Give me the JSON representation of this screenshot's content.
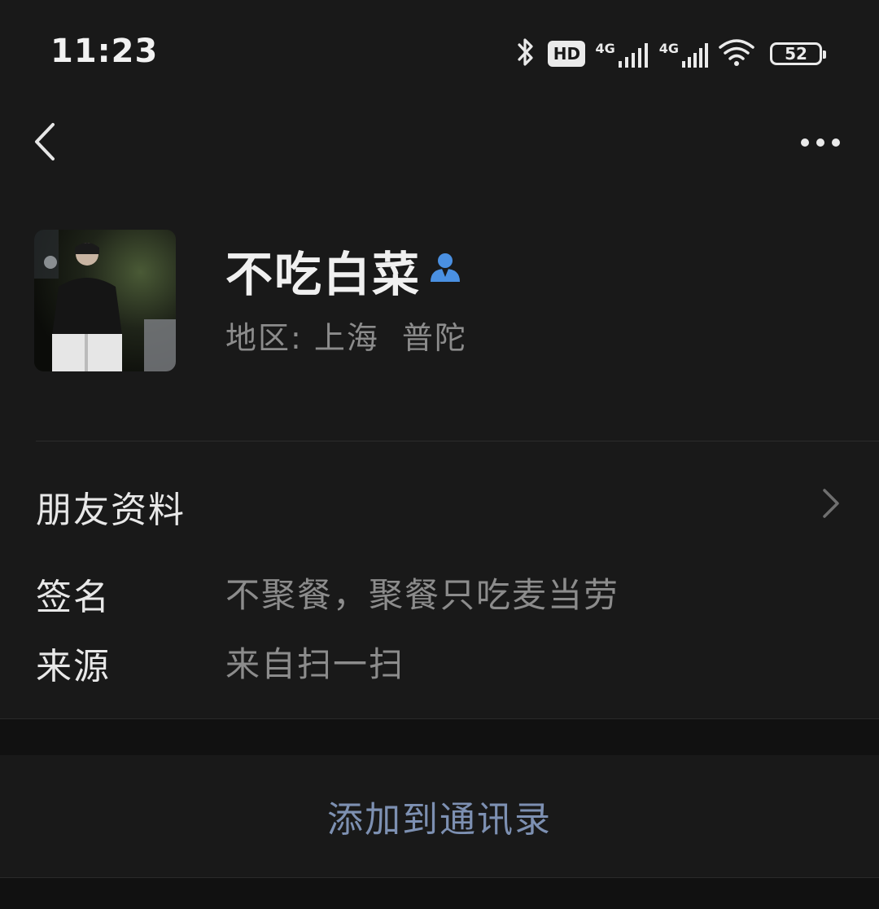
{
  "status_bar": {
    "time": "11:23",
    "hd_label": "HD",
    "net1_label": "4G",
    "net2_label": "4G",
    "battery_level": "52",
    "icons": [
      "bluetooth-icon",
      "hd-icon",
      "signal-icon",
      "signal-icon",
      "wifi-icon",
      "battery-icon"
    ]
  },
  "nav": {
    "back_icon": "chevron-left-icon",
    "more_icon": "more-dots-icon"
  },
  "profile": {
    "name": "不吃白菜",
    "region_label": "地区:",
    "region_city": "上海",
    "region_district": "普陀",
    "accent_color": "#4a90e2"
  },
  "friend_info": {
    "label": "朋友资料"
  },
  "details": {
    "signature_label": "签名",
    "signature_value": "不聚餐，聚餐只吃麦当劳",
    "source_label": "来源",
    "source_value": "来自扫一扫"
  },
  "action": {
    "add_to_contacts": "添加到通讯录",
    "color": "#7d90b2"
  }
}
